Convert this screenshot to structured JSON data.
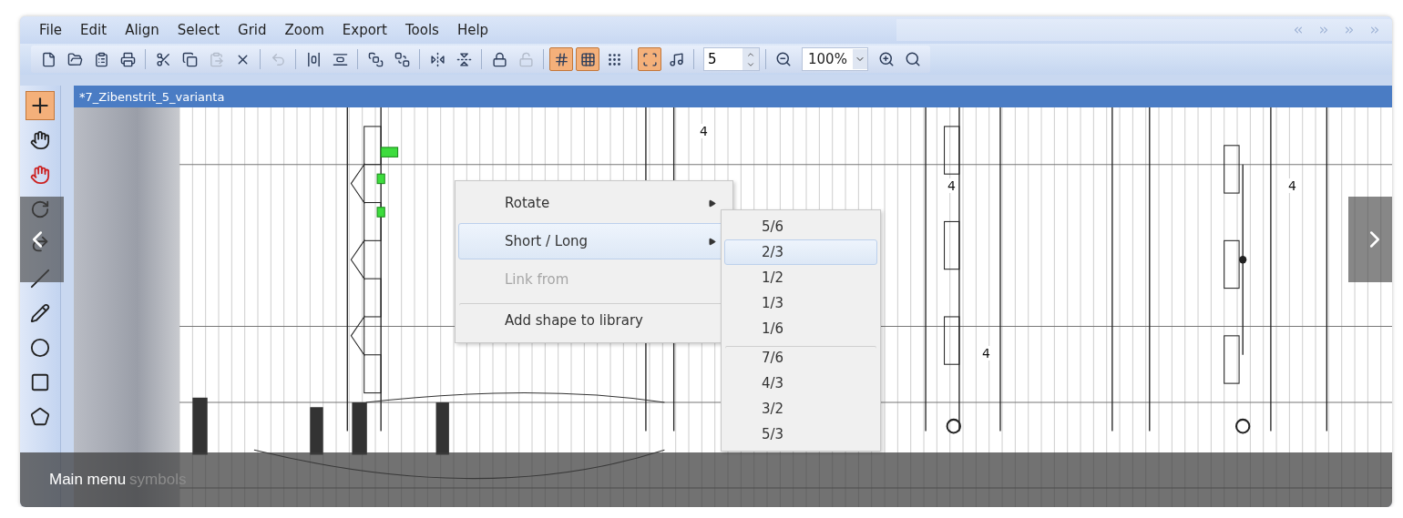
{
  "menu_bar": [
    {
      "label": "File"
    },
    {
      "label": "Edit"
    },
    {
      "label": "Align"
    },
    {
      "label": "Select"
    },
    {
      "label": "Grid"
    },
    {
      "label": "Zoom"
    },
    {
      "label": "Export"
    },
    {
      "label": "Tools"
    },
    {
      "label": "Help"
    }
  ],
  "toolbar": {
    "buttons": [
      {
        "kind": "new",
        "on": false,
        "disabled": false
      },
      {
        "kind": "open",
        "on": false,
        "disabled": false
      },
      {
        "kind": "paste-special",
        "on": false,
        "disabled": false
      },
      {
        "kind": "print",
        "on": false,
        "disabled": false
      },
      {
        "kind": "cut",
        "on": false,
        "disabled": false
      },
      {
        "kind": "copy",
        "on": false,
        "disabled": false
      },
      {
        "kind": "paste",
        "on": false,
        "disabled": true
      },
      {
        "kind": "delete",
        "on": false,
        "disabled": false
      },
      {
        "kind": "undo",
        "on": false,
        "disabled": true
      },
      {
        "kind": "align-h",
        "on": false,
        "disabled": false
      },
      {
        "kind": "align-v",
        "on": false,
        "disabled": false
      },
      {
        "kind": "front",
        "on": false,
        "disabled": false
      },
      {
        "kind": "back",
        "on": false,
        "disabled": false
      },
      {
        "kind": "flip-h",
        "on": false,
        "disabled": false
      },
      {
        "kind": "flip-v",
        "on": false,
        "disabled": false
      },
      {
        "kind": "lock",
        "on": false,
        "disabled": false
      },
      {
        "kind": "unlock",
        "on": false,
        "disabled": true
      },
      {
        "kind": "snap",
        "on": true,
        "disabled": false
      },
      {
        "kind": "grid",
        "on": true,
        "disabled": false
      },
      {
        "kind": "dots",
        "on": false,
        "disabled": false
      },
      {
        "kind": "select-area",
        "on": true,
        "disabled": false
      },
      {
        "kind": "note",
        "on": false,
        "disabled": false
      }
    ],
    "step_value": "5",
    "zoom_value": "100%"
  },
  "document_tab": "*7_Zibenstrit_5_varianta",
  "tools": [
    {
      "kind": "crosshair",
      "selected": true
    },
    {
      "kind": "hand",
      "selected": false
    },
    {
      "kind": "hand-erase",
      "selected": false
    },
    {
      "kind": "rotate",
      "selected": false
    },
    {
      "kind": "redo",
      "selected": false
    },
    {
      "kind": "line",
      "selected": false
    },
    {
      "kind": "pencil",
      "selected": false
    },
    {
      "kind": "circle",
      "selected": false
    },
    {
      "kind": "rectangle",
      "selected": false
    },
    {
      "kind": "shape",
      "selected": false
    }
  ],
  "canvas_labels": [
    {
      "text": "4"
    },
    {
      "text": "4"
    },
    {
      "text": "4"
    },
    {
      "text": "4"
    }
  ],
  "context_menu": {
    "items": [
      {
        "label": "Rotate",
        "submenu": true,
        "disabled": false,
        "highlighted": false,
        "separator_before": false
      },
      {
        "label": "Short / Long",
        "submenu": true,
        "disabled": false,
        "highlighted": true,
        "separator_before": false
      },
      {
        "label": "Link from",
        "submenu": false,
        "disabled": true,
        "highlighted": false,
        "separator_before": false
      },
      {
        "label": "Add shape to library",
        "submenu": false,
        "disabled": false,
        "highlighted": false,
        "separator_before": true
      }
    ]
  },
  "submenu": {
    "items": [
      {
        "label": "5/6",
        "selected": false,
        "separator_before": false
      },
      {
        "label": "2/3",
        "selected": true,
        "separator_before": false
      },
      {
        "label": "1/2",
        "selected": false,
        "separator_before": false
      },
      {
        "label": "1/3",
        "selected": false,
        "separator_before": false
      },
      {
        "label": "1/6",
        "selected": false,
        "separator_before": false
      },
      {
        "label": "7/6",
        "selected": false,
        "separator_before": true
      },
      {
        "label": "4/3",
        "selected": false,
        "separator_before": false
      },
      {
        "label": "3/2",
        "selected": false,
        "separator_before": false
      },
      {
        "label": "5/3",
        "selected": false,
        "separator_before": false
      }
    ]
  },
  "caption": {
    "title": "Main menu",
    "ghost_text": "symbols"
  }
}
